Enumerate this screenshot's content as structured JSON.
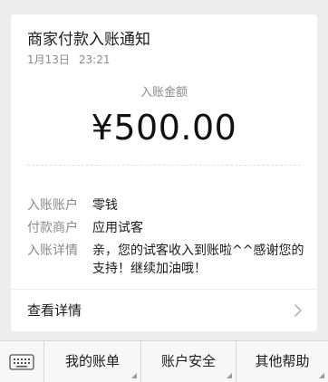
{
  "notification": {
    "title": "商家付款入账通知",
    "date": "1月13日",
    "time": "23:21",
    "amount_label": "入账金额",
    "amount": "¥500.00",
    "rows": [
      {
        "key": "入账账户",
        "value": "零钱"
      },
      {
        "key": "付款商户",
        "value": "应用试客"
      },
      {
        "key": "入账详情",
        "value": "亲，您的试客收入到账啦^^感谢您的支持！继续加油哦！"
      }
    ],
    "view_detail": "查看详情"
  },
  "menu": {
    "keyboard_icon": "keyboard-icon",
    "items": [
      {
        "label": "我的账单"
      },
      {
        "label": "账户安全"
      },
      {
        "label": "其他帮助"
      }
    ]
  },
  "colors": {
    "background": "#ededed",
    "card": "#ffffff",
    "muted_text": "#8a8a8a"
  }
}
